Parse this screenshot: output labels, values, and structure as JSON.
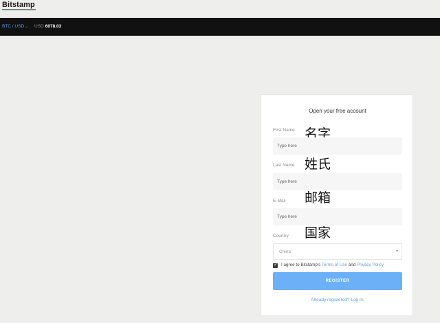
{
  "header": {
    "logo_text": "Bitstamp"
  },
  "ticker": {
    "pair": "BTC / USD",
    "pair_chevron": "⌄",
    "currency": "USD",
    "price": "6078.03"
  },
  "signup": {
    "title": "Open your free account",
    "fields": [
      {
        "label": "First Name",
        "placeholder": "Type here",
        "annotation": "名字"
      },
      {
        "label": "Last Name",
        "placeholder": "Type here",
        "annotation": "姓氏"
      },
      {
        "label": "E-Mail",
        "placeholder": "Type here",
        "annotation": "邮箱"
      }
    ],
    "country": {
      "label": "Country",
      "value": "China",
      "annotation": "国家"
    },
    "agree": {
      "checked": true,
      "prefix": "I agree to Bitstamp's",
      "terms_link": "Terms of Use",
      "and": "and",
      "privacy_link": "Privacy Policy"
    },
    "register_label": "REGISTER",
    "login_link": "Already registered? Log in."
  },
  "colors": {
    "accent": "#5b9df0",
    "button": "#6cb0f7",
    "pricebar": "#111111",
    "logo_underline": "#2fb56a"
  }
}
